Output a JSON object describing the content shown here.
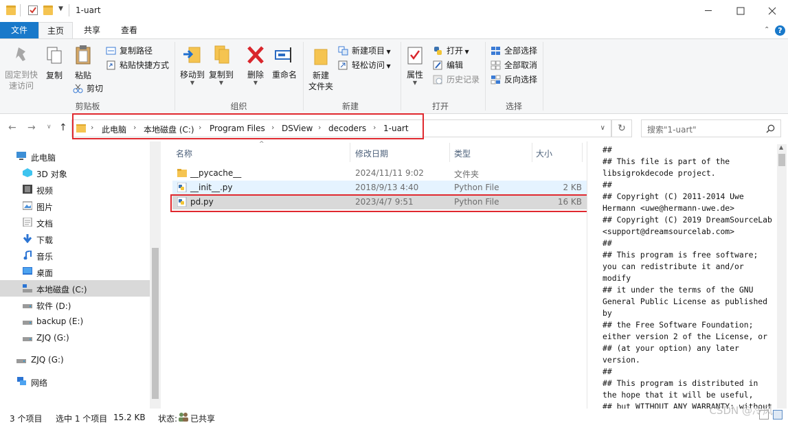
{
  "window": {
    "title": "1-uart",
    "controls": [
      "minimize",
      "maximize",
      "close"
    ]
  },
  "ribbon_tabs": {
    "file": "文件",
    "home": "主页",
    "share": "共享",
    "view": "查看"
  },
  "ribbon": {
    "clipboard": {
      "group": "剪贴板",
      "pin": "固定到快\n速访问",
      "copy": "复制",
      "paste": "粘贴",
      "copy_path": "复制路径",
      "paste_shortcut": "粘贴快捷方式",
      "cut": "剪切"
    },
    "organize": {
      "group": "组织",
      "move_to": "移动到",
      "copy_to": "复制到",
      "delete": "删除",
      "rename": "重命名"
    },
    "new": {
      "group": "新建",
      "new_folder": "新建\n文件夹",
      "new_item": "新建项目",
      "easy_access": "轻松访问"
    },
    "open": {
      "group": "打开",
      "properties": "属性",
      "open": "打开",
      "edit": "编辑",
      "history": "历史记录"
    },
    "select": {
      "group": "选择",
      "select_all": "全部选择",
      "select_none": "全部取消",
      "invert": "反向选择"
    }
  },
  "address": {
    "crumbs": [
      "此电脑",
      "本地磁盘 (C:)",
      "Program Files",
      "DSView",
      "decoders",
      "1-uart"
    ],
    "search_placeholder": "搜索\"1-uart\""
  },
  "sidebar": {
    "items": [
      {
        "label": "此电脑",
        "icon": "computer-icon"
      },
      {
        "label": "3D 对象",
        "icon": "3d-objects-icon"
      },
      {
        "label": "视频",
        "icon": "video-icon"
      },
      {
        "label": "图片",
        "icon": "pictures-icon"
      },
      {
        "label": "文档",
        "icon": "documents-icon"
      },
      {
        "label": "下载",
        "icon": "download-icon"
      },
      {
        "label": "音乐",
        "icon": "music-icon"
      },
      {
        "label": "桌面",
        "icon": "desktop-icon"
      },
      {
        "label": "本地磁盘 (C:)",
        "icon": "drive-c-icon",
        "selected": true
      },
      {
        "label": "软件 (D:)",
        "icon": "drive-icon"
      },
      {
        "label": "backup (E:)",
        "icon": "drive-icon"
      },
      {
        "label": "ZJQ (G:)",
        "icon": "drive-icon"
      },
      {
        "label": "ZJQ (G:)",
        "icon": "drive-icon"
      },
      {
        "label": "网络",
        "icon": "network-icon"
      }
    ]
  },
  "filelist": {
    "columns": {
      "name": "名称",
      "modified": "修改日期",
      "type": "类型",
      "size": "大小"
    },
    "rows": [
      {
        "name": "__pycache__",
        "modified": "2024/11/11 9:02",
        "type": "文件夹",
        "size": "",
        "icon": "folder-icon"
      },
      {
        "name": "__init__.py",
        "modified": "2018/9/13 4:40",
        "type": "Python File",
        "size": "2 KB",
        "icon": "python-file-icon"
      },
      {
        "name": "pd.py",
        "modified": "2023/4/7 9:51",
        "type": "Python File",
        "size": "16 KB",
        "icon": "python-file-icon"
      }
    ]
  },
  "preview": {
    "text": "##\n## This file is part of the\nlibsigrokdecode project.\n##\n## Copyright (C) 2011-2014 Uwe\nHermann <uwe@hermann-uwe.de>\n## Copyright (C) 2019 DreamSourceLab\n<support@dreamsourcelab.com>\n##\n## This program is free software;\nyou can redistribute it and/or\nmodify\n## it under the terms of the GNU\nGeneral Public License as published\nby\n## the Free Software Foundation;\neither version 2 of the License, or\n## (at your option) any later\nversion.\n##\n## This program is distributed in\nthe hope that it will be useful,\n## but WITHOUT ANY WARRANTY; without"
  },
  "statusbar": {
    "count": "3 个项目",
    "selected": "选中 1 个项目",
    "size": "15.2 KB",
    "state_label": "状态:",
    "state_value": "已共享"
  },
  "watermark": "CSDN @冷风"
}
